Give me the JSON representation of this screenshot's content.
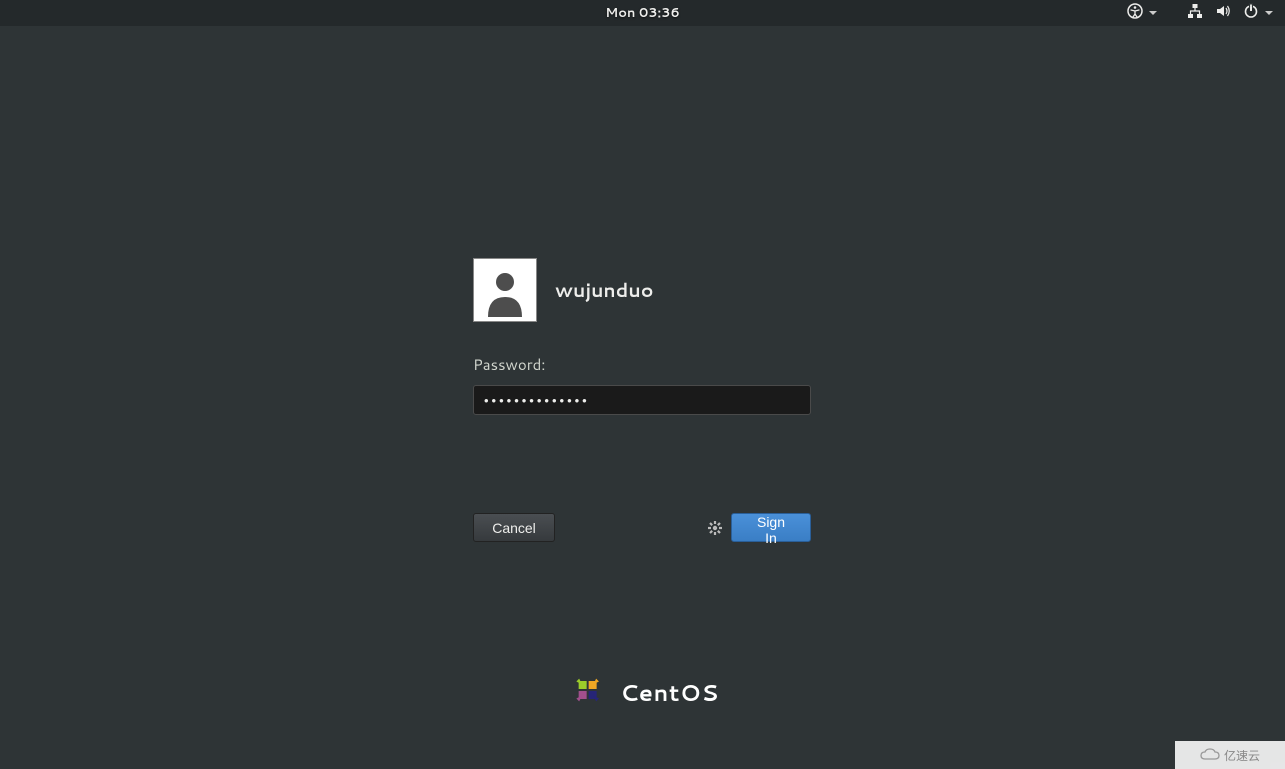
{
  "topbar": {
    "datetime": "Mon 03:36"
  },
  "login": {
    "username": "wujunduo",
    "password_label": "Password:",
    "password_value": "••••••••••••••",
    "cancel_label": "Cancel",
    "signin_label": "Sign In"
  },
  "branding": {
    "os_name": "CentOS"
  },
  "watermark": {
    "text": "亿速云"
  },
  "icons": {
    "accessibility": "accessibility-icon",
    "network": "network-wired-icon",
    "volume": "volume-icon",
    "power": "power-icon",
    "gear": "settings-gear-icon",
    "avatar": "user-avatar-icon"
  }
}
